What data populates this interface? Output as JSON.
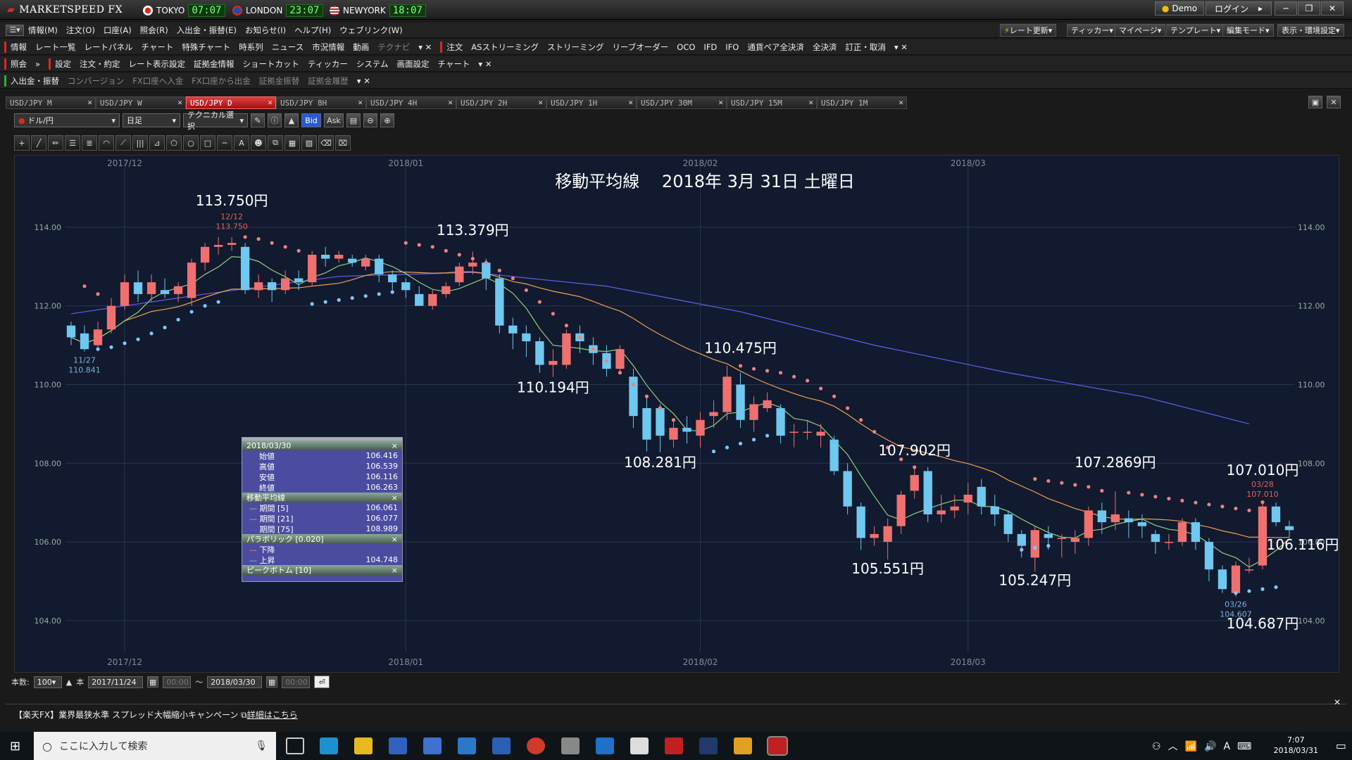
{
  "app": {
    "logo": "MARKETSPEED FX"
  },
  "clocks": [
    {
      "city": "TOKYO",
      "time": "07:07",
      "flag": "#d52b1e"
    },
    {
      "city": "LONDON",
      "time": "23:07",
      "flag": "#1d4fa8"
    },
    {
      "city": "NEWYORK",
      "time": "18:07",
      "flag": "#b22234"
    }
  ],
  "window": {
    "demo": "Demo",
    "login": "ログイン"
  },
  "menu": [
    "情報(M)",
    "注文(O)",
    "口座(A)",
    "照会(R)",
    "入出金・振替(E)",
    "お知らせ(I)",
    "ヘルプ(H)",
    "ウェブリンク(W)"
  ],
  "right_buttons": [
    "レート更新",
    "ティッカー",
    "マイページ",
    "テンプレート",
    "編集モード",
    "表示・環境設定"
  ],
  "toolbar1": {
    "section": "情報",
    "items": [
      "レート一覧",
      "レートパネル",
      "チャート",
      "特殊チャート",
      "時系列",
      "ニュース",
      "市況情報",
      "動画"
    ],
    "dim": "テクナビ",
    "section2": "注文",
    "items2": [
      "ASストリーミング",
      "ストリーミング",
      "リーブオーダー",
      "OCO",
      "IFD",
      "IFO",
      "通貨ペア全決済",
      "全決済",
      "訂正・取消"
    ]
  },
  "toolbar2": {
    "section": "照会",
    "section2": "設定",
    "items": [
      "注文・約定",
      "レート表示設定",
      "証拠金情報",
      "ショートカット",
      "ティッカー",
      "システム",
      "画面設定",
      "チャート"
    ]
  },
  "toolbar3": {
    "section": "入出金・振替",
    "dim_items": [
      "コンバージョン",
      "FX口座へ入金",
      "FX口座から出金",
      "証拠金振替",
      "証拠金履歴"
    ]
  },
  "tabs": [
    "USD/JPY M",
    "USD/JPY W",
    "USD/JPY D",
    "USD/JPY 8H",
    "USD/JPY 4H",
    "USD/JPY 2H",
    "USD/JPY 1H",
    "USD/JPY 30M",
    "USD/JPY 15M",
    "USD/JPY 1M"
  ],
  "active_tab": 2,
  "controls": {
    "pair": "ドル/円",
    "period": "日足",
    "tech": "テクニカル選択",
    "bid": "Bid",
    "ask": "Ask"
  },
  "chart_data": {
    "type": "candlestick",
    "title": "移動平均線　 2018年 3月 31日 土曜日",
    "ylim": [
      103.3,
      115.5
    ],
    "yticks": [
      "114.00",
      "112.00",
      "110.00",
      "108.00",
      "106.00",
      "104.00"
    ],
    "yticks_values": [
      114,
      112,
      110,
      108,
      106,
      104
    ],
    "month_labels": [
      {
        "label": "2017/12",
        "i": 4
      },
      {
        "label": "2018/01",
        "i": 25
      },
      {
        "label": "2018/02",
        "i": 47
      },
      {
        "label": "2018/03",
        "i": 67
      }
    ],
    "candles": [
      [
        111.5,
        111.2,
        111.6,
        111.0
      ],
      [
        111.3,
        110.9,
        111.5,
        110.84
      ],
      [
        111.0,
        111.4,
        111.6,
        110.9
      ],
      [
        111.4,
        112.0,
        112.2,
        111.3
      ],
      [
        112.0,
        112.6,
        112.8,
        111.9
      ],
      [
        112.6,
        112.3,
        112.9,
        112.1
      ],
      [
        112.3,
        112.6,
        112.8,
        112.1
      ],
      [
        112.4,
        112.3,
        112.7,
        112.2
      ],
      [
        112.3,
        112.5,
        112.6,
        112.1
      ],
      [
        112.2,
        113.1,
        113.2,
        112.0
      ],
      [
        113.1,
        113.5,
        113.6,
        112.9
      ],
      [
        113.5,
        113.55,
        113.75,
        113.3
      ],
      [
        113.55,
        113.6,
        113.75,
        113.4
      ],
      [
        113.5,
        112.4,
        113.6,
        112.3
      ],
      [
        112.4,
        112.6,
        112.8,
        112.2
      ],
      [
        112.6,
        112.4,
        112.7,
        112.1
      ],
      [
        112.4,
        112.7,
        112.9,
        112.3
      ],
      [
        112.7,
        112.6,
        112.9,
        112.4
      ],
      [
        112.6,
        113.3,
        113.4,
        112.5
      ],
      [
        113.3,
        113.2,
        113.5,
        113.0
      ],
      [
        113.2,
        113.3,
        113.4,
        113.1
      ],
      [
        113.2,
        113.1,
        113.3,
        113.0
      ],
      [
        113.0,
        113.2,
        113.3,
        112.9
      ],
      [
        113.2,
        112.8,
        113.3,
        112.6
      ],
      [
        112.8,
        112.6,
        112.9,
        112.4
      ],
      [
        112.6,
        112.4,
        112.7,
        112.2
      ],
      [
        112.3,
        112.0,
        112.5,
        112.1
      ],
      [
        112.0,
        112.3,
        112.4,
        111.9
      ],
      [
        112.3,
        112.5,
        112.6,
        112.2
      ],
      [
        112.6,
        113.0,
        113.1,
        112.5
      ],
      [
        113.0,
        113.1,
        113.379,
        112.8
      ],
      [
        113.1,
        112.7,
        113.2,
        112.4
      ],
      [
        112.7,
        111.5,
        112.8,
        111.3
      ],
      [
        111.5,
        111.3,
        111.7,
        110.9
      ],
      [
        111.3,
        111.1,
        111.5,
        110.7
      ],
      [
        111.1,
        110.5,
        111.2,
        110.3
      ],
      [
        110.5,
        110.6,
        110.9,
        110.194
      ],
      [
        110.5,
        111.3,
        111.4,
        110.4
      ],
      [
        111.3,
        111.1,
        111.5,
        110.8
      ],
      [
        111.0,
        110.8,
        111.2,
        110.5
      ],
      [
        110.8,
        110.4,
        111.0,
        110.2
      ],
      [
        110.4,
        110.9,
        111.0,
        110.3
      ],
      [
        110.2,
        109.2,
        110.4,
        108.9
      ],
      [
        109.4,
        108.6,
        109.7,
        108.3
      ],
      [
        109.4,
        108.7,
        109.5,
        108.281
      ],
      [
        108.6,
        108.9,
        109.1,
        108.4
      ],
      [
        108.9,
        108.8,
        109.2,
        108.5
      ],
      [
        108.7,
        109.1,
        109.3,
        108.4
      ],
      [
        109.2,
        109.3,
        109.6,
        108.9
      ],
      [
        109.3,
        110.2,
        110.475,
        109.1
      ],
      [
        110.0,
        109.1,
        110.3,
        108.9
      ],
      [
        109.1,
        109.5,
        109.7,
        108.8
      ],
      [
        109.4,
        109.6,
        109.8,
        109.3
      ],
      [
        109.4,
        108.7,
        109.5,
        108.5
      ],
      [
        108.8,
        108.8,
        109.0,
        108.4
      ],
      [
        108.8,
        108.8,
        109.1,
        108.6
      ],
      [
        108.7,
        108.8,
        109.0,
        108.4
      ],
      [
        108.6,
        107.8,
        108.7,
        107.7
      ],
      [
        107.8,
        106.9,
        108.0,
        106.7
      ],
      [
        106.9,
        106.1,
        107.0,
        105.8
      ],
      [
        106.1,
        106.2,
        106.4,
        105.9
      ],
      [
        106.0,
        106.4,
        106.6,
        105.551
      ],
      [
        106.4,
        107.2,
        107.3,
        106.2
      ],
      [
        107.3,
        107.7,
        107.902,
        107.1
      ],
      [
        107.8,
        106.7,
        107.9,
        106.5
      ],
      [
        106.7,
        106.8,
        107.2,
        106.5
      ],
      [
        106.8,
        106.9,
        107.2,
        106.6
      ],
      [
        107.0,
        107.2,
        107.5,
        106.7
      ],
      [
        107.4,
        106.9,
        107.6,
        106.7
      ],
      [
        106.9,
        106.7,
        107.2,
        106.4
      ],
      [
        106.7,
        106.2,
        106.8,
        106.0
      ],
      [
        106.2,
        105.9,
        106.3,
        105.6
      ],
      [
        105.6,
        106.3,
        106.4,
        105.247
      ],
      [
        106.2,
        106.1,
        106.4,
        105.8
      ],
      [
        106.1,
        106.1,
        106.2,
        105.6
      ],
      [
        106.0,
        106.1,
        106.3,
        105.7
      ],
      [
        106.1,
        106.8,
        106.9,
        105.9
      ],
      [
        106.8,
        106.5,
        107.0,
        106.2
      ],
      [
        106.5,
        106.7,
        107.2869,
        106.3
      ],
      [
        106.6,
        106.5,
        106.8,
        106.1
      ],
      [
        106.5,
        106.4,
        106.7,
        106.1
      ],
      [
        106.2,
        106.0,
        106.3,
        105.7
      ],
      [
        106.0,
        106.0,
        106.2,
        105.8
      ],
      [
        106.0,
        106.5,
        106.6,
        105.9
      ],
      [
        106.5,
        106.0,
        106.6,
        105.8
      ],
      [
        106.0,
        105.3,
        106.1,
        105.0
      ],
      [
        105.3,
        104.8,
        105.4,
        104.7
      ],
      [
        104.7,
        105.4,
        105.5,
        104.607
      ],
      [
        105.3,
        105.3,
        105.6,
        105.2
      ],
      [
        105.4,
        106.9,
        107.01,
        105.3
      ],
      [
        106.9,
        106.5,
        107.0,
        106.4
      ],
      [
        106.4,
        106.3,
        106.54,
        106.116
      ]
    ],
    "ma5_color": "#8fcf7f",
    "ma21_color": "#f0a050",
    "ma75_color": "#5a5ae0",
    "ma75": [
      [
        0,
        111.8
      ],
      [
        10,
        112.3
      ],
      [
        20,
        112.75
      ],
      [
        30,
        112.85
      ],
      [
        40,
        112.5
      ],
      [
        50,
        111.85
      ],
      [
        60,
        111.0
      ],
      [
        70,
        110.3
      ],
      [
        80,
        109.7
      ],
      [
        88,
        109.0
      ]
    ],
    "psar_up": [
      [
        2,
        110.9
      ],
      [
        3,
        110.95
      ],
      [
        4,
        111.05
      ],
      [
        5,
        111.15
      ],
      [
        6,
        111.3
      ],
      [
        7,
        111.45
      ],
      [
        8,
        111.65
      ],
      [
        9,
        111.85
      ],
      [
        10,
        112.0
      ],
      [
        11,
        112.1
      ],
      [
        18,
        112.05
      ],
      [
        19,
        112.1
      ],
      [
        20,
        112.15
      ],
      [
        21,
        112.2
      ],
      [
        22,
        112.25
      ],
      [
        23,
        112.3
      ],
      [
        24,
        112.35
      ],
      [
        48,
        108.3
      ],
      [
        49,
        108.4
      ],
      [
        50,
        108.5
      ],
      [
        51,
        108.6
      ],
      [
        52,
        108.7
      ],
      [
        71,
        105.8
      ],
      [
        72,
        105.85
      ],
      [
        73,
        105.9
      ],
      [
        87,
        104.7
      ],
      [
        88,
        104.75
      ],
      [
        89,
        104.8
      ],
      [
        90,
        104.85
      ]
    ],
    "psar_down": [
      [
        1,
        112.5
      ],
      [
        2,
        112.3
      ],
      [
        13,
        113.75
      ],
      [
        14,
        113.7
      ],
      [
        15,
        113.6
      ],
      [
        16,
        113.5
      ],
      [
        17,
        113.4
      ],
      [
        25,
        113.6
      ],
      [
        26,
        113.55
      ],
      [
        27,
        113.5
      ],
      [
        28,
        113.4
      ],
      [
        29,
        113.3
      ],
      [
        30,
        113.2
      ],
      [
        31,
        113.1
      ],
      [
        32,
        112.9
      ],
      [
        33,
        112.7
      ],
      [
        34,
        112.4
      ],
      [
        35,
        112.1
      ],
      [
        36,
        111.8
      ],
      [
        37,
        111.5
      ],
      [
        38,
        111.2
      ],
      [
        39,
        110.9
      ],
      [
        40,
        110.6
      ],
      [
        41,
        110.3
      ],
      [
        42,
        110.0
      ],
      [
        43,
        109.7
      ],
      [
        44,
        109.4
      ],
      [
        45,
        109.1
      ],
      [
        50,
        110.475
      ],
      [
        51,
        110.4
      ],
      [
        52,
        110.35
      ],
      [
        53,
        110.3
      ],
      [
        54,
        110.2
      ],
      [
        55,
        110.1
      ],
      [
        56,
        109.9
      ],
      [
        57,
        109.7
      ],
      [
        58,
        109.4
      ],
      [
        59,
        109.1
      ],
      [
        60,
        108.8
      ],
      [
        61,
        108.4
      ],
      [
        62,
        108.1
      ],
      [
        63,
        107.9
      ],
      [
        72,
        107.6
      ],
      [
        73,
        107.55
      ],
      [
        74,
        107.5
      ],
      [
        75,
        107.45
      ],
      [
        76,
        107.4
      ],
      [
        77,
        107.3
      ],
      [
        79,
        107.25
      ],
      [
        80,
        107.2
      ],
      [
        81,
        107.15
      ],
      [
        82,
        107.1
      ],
      [
        83,
        107.05
      ],
      [
        84,
        107.0
      ],
      [
        85,
        106.95
      ],
      [
        86,
        106.9
      ],
      [
        87,
        106.85
      ],
      [
        88,
        106.8
      ],
      [
        89,
        107.01
      ]
    ],
    "annotations": [
      {
        "text": "113.750円",
        "i": 12,
        "y": 114.55
      },
      {
        "text": "113.379円",
        "i": 30,
        "y": 113.8
      },
      {
        "text": "110.475円",
        "i": 50,
        "y": 110.8
      },
      {
        "text": "110.194円",
        "i": 36,
        "y": 109.8
      },
      {
        "text": "108.281円",
        "i": 44,
        "y": 107.9
      },
      {
        "text": "107.902円",
        "i": 63,
        "y": 108.2
      },
      {
        "text": "107.2869円",
        "i": 78,
        "y": 107.9
      },
      {
        "text": "107.010円",
        "i": 89,
        "y": 107.7
      },
      {
        "text": "105.551円",
        "i": 61,
        "y": 105.2
      },
      {
        "text": "105.247円",
        "i": 72,
        "y": 104.9
      },
      {
        "text": "106.116円",
        "i": 92,
        "y": 105.8
      },
      {
        "text": "104.687円",
        "i": 89,
        "y": 103.8
      }
    ],
    "small_labels": [
      {
        "text": "12/12",
        "i": 12,
        "y": 114.2,
        "color": "#e06060"
      },
      {
        "text": "113.750",
        "i": 12,
        "y": 113.95,
        "color": "#e06060"
      },
      {
        "text": "11/27",
        "i": 1,
        "y": 110.55,
        "color": "#7fb0e0"
      },
      {
        "text": "110.841",
        "i": 1,
        "y": 110.3,
        "color": "#7fb0e0"
      },
      {
        "text": "03/28",
        "i": 89,
        "y": 107.4,
        "color": "#e06060"
      },
      {
        "text": "107.010",
        "i": 89,
        "y": 107.15,
        "color": "#e06060"
      },
      {
        "text": "03/26",
        "i": 87,
        "y": 104.35,
        "color": "#7fb0e0"
      },
      {
        "text": "104.607",
        "i": 87,
        "y": 104.1,
        "color": "#7fb0e0"
      }
    ]
  },
  "datapanel": {
    "date": "2018/03/30",
    "ohlc": [
      {
        "k": "始値",
        "v": "106.416"
      },
      {
        "k": "高値",
        "v": "106.539"
      },
      {
        "k": "安値",
        "v": "106.116"
      },
      {
        "k": "終値",
        "v": "106.263"
      }
    ],
    "ma_title": "移動平均線",
    "ma": [
      {
        "k": "期間 [5]",
        "v": "106.061"
      },
      {
        "k": "期間 [21]",
        "v": "106.077"
      },
      {
        "k": "期間 [75]",
        "v": "108.989"
      }
    ],
    "psar_title": "パラボリック [0.020]",
    "psar": [
      {
        "k": "下降",
        "v": ""
      },
      {
        "k": "上昇",
        "v": "104.748"
      }
    ],
    "peak_title": "ピークボトム [10]"
  },
  "bottom": {
    "count_label": "本数:",
    "count": "100",
    "unit": "本",
    "from": "2017/11/24",
    "from_time": "00:00",
    "to": "2018/03/30",
    "to_time": "00:00",
    "tilde": "〜"
  },
  "news": "【楽天FX】業界最狭水準 スプレッド大幅縮小キャンペーン",
  "news_link": "詳細はこちら",
  "taskbar": {
    "search": "ここに入力して検索",
    "time": "7:07",
    "date": "2018/03/31"
  }
}
